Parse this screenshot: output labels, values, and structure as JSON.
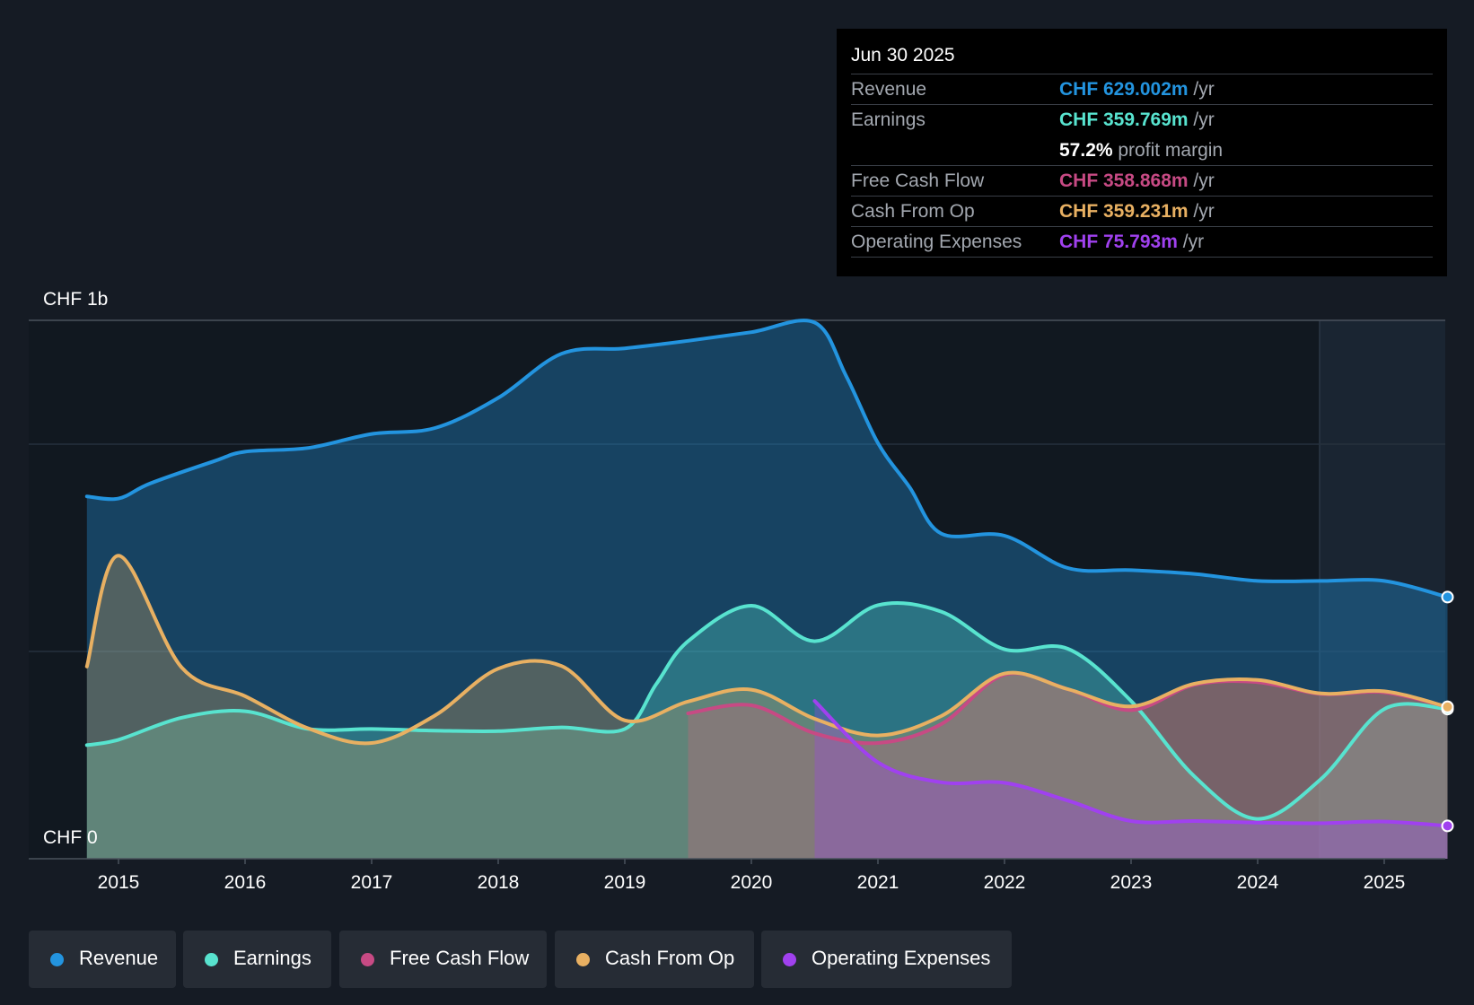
{
  "chart_data": {
    "type": "area",
    "y_labels": {
      "top": "CHF 1b",
      "bottom": "CHF 0"
    },
    "ylim": [
      0,
      1000
    ],
    "x_ticks": [
      "2015",
      "2016",
      "2017",
      "2018",
      "2019",
      "2020",
      "2021",
      "2022",
      "2023",
      "2024",
      "2025"
    ],
    "series": [
      {
        "name": "Revenue",
        "color": "#2394df",
        "x": [
          2014.75,
          2015.0,
          2015.25,
          2015.75,
          2016.0,
          2016.5,
          2017.0,
          2017.5,
          2018.0,
          2018.5,
          2019.0,
          2019.5,
          2020.0,
          2020.5,
          2020.75,
          2021.0,
          2021.25,
          2021.5,
          2022.0,
          2022.5,
          2023.0,
          2023.5,
          2024.0,
          2024.5,
          2025.0,
          2025.5
        ],
        "y": [
          673,
          669,
          697,
          738,
          756,
          763,
          789,
          800,
          856,
          938,
          948,
          962,
          978,
          996,
          896,
          772,
          690,
          604,
          600,
          540,
          536,
          529,
          516,
          516,
          516,
          486
        ]
      },
      {
        "name": "Earnings",
        "color": "#58e3cf",
        "x": [
          2014.75,
          2015.0,
          2015.5,
          2016.0,
          2016.5,
          2017.0,
          2017.5,
          2018.0,
          2018.5,
          2019.0,
          2019.25,
          2019.5,
          2020.0,
          2020.5,
          2021.0,
          2021.5,
          2022.0,
          2022.5,
          2023.0,
          2023.5,
          2024.0,
          2024.5,
          2025.0,
          2025.5
        ],
        "y": [
          211,
          221,
          262,
          274,
          241,
          241,
          238,
          237,
          244,
          241,
          325,
          404,
          470,
          404,
          471,
          459,
          389,
          390,
          293,
          153,
          74,
          148,
          278,
          278
        ]
      },
      {
        "name": "Free Cash Flow",
        "color": "#c74a84",
        "x": [
          2019.5,
          2020.0,
          2020.5,
          2021.0,
          2021.5,
          2022.0,
          2022.5,
          2023.0,
          2023.5,
          2024.0,
          2024.5,
          2025.0,
          2025.5
        ],
        "y": [
          270,
          285,
          233,
          215,
          250,
          342,
          315,
          276,
          323,
          328,
          306,
          309,
          282
        ]
      },
      {
        "name": "Cash From Op",
        "color": "#e8b062",
        "x": [
          2014.75,
          2015.0,
          2015.5,
          2016.0,
          2016.5,
          2017.0,
          2017.5,
          2018.0,
          2018.5,
          2019.0,
          2019.5,
          2020.0,
          2020.5,
          2021.0,
          2021.5,
          2022.0,
          2022.5,
          2023.0,
          2023.5,
          2024.0,
          2024.5,
          2025.0,
          2025.5
        ],
        "y": [
          357,
          563,
          355,
          302,
          242,
          215,
          266,
          353,
          358,
          257,
          292,
          314,
          260,
          229,
          265,
          344,
          315,
          283,
          325,
          332,
          307,
          311,
          282
        ]
      },
      {
        "name": "Operating Expenses",
        "color": "#a041ef",
        "x": [
          2020.5,
          2021.0,
          2021.5,
          2022.0,
          2022.5,
          2023.0,
          2023.5,
          2024.0,
          2024.5,
          2025.0,
          2025.5
        ],
        "y": [
          293,
          179,
          142,
          141,
          108,
          70,
          70,
          67,
          66,
          69,
          61
        ]
      }
    ]
  },
  "tooltip": {
    "date": "Jun 30 2025",
    "rows": [
      {
        "label": "Revenue",
        "value": "CHF 629.002m",
        "unit": " /yr",
        "color": "#2394df"
      },
      {
        "label": "Earnings",
        "value": "CHF 359.769m",
        "unit": " /yr",
        "color": "#58e3cf"
      },
      {
        "label": "",
        "value": "57.2%",
        "unit": " profit margin",
        "color": "#ffffff"
      },
      {
        "label": "Free Cash Flow",
        "value": "CHF 358.868m",
        "unit": " /yr",
        "color": "#c74a84"
      },
      {
        "label": "Cash From Op",
        "value": "CHF 359.231m",
        "unit": " /yr",
        "color": "#e8b062"
      },
      {
        "label": "Operating Expenses",
        "value": "CHF 75.793m",
        "unit": " /yr",
        "color": "#a041ef"
      }
    ]
  },
  "legend": [
    {
      "label": "Revenue",
      "color": "#2394df"
    },
    {
      "label": "Earnings",
      "color": "#58e3cf"
    },
    {
      "label": "Free Cash Flow",
      "color": "#c74a84"
    },
    {
      "label": "Cash From Op",
      "color": "#e8b062"
    },
    {
      "label": "Operating Expenses",
      "color": "#a041ef"
    }
  ]
}
